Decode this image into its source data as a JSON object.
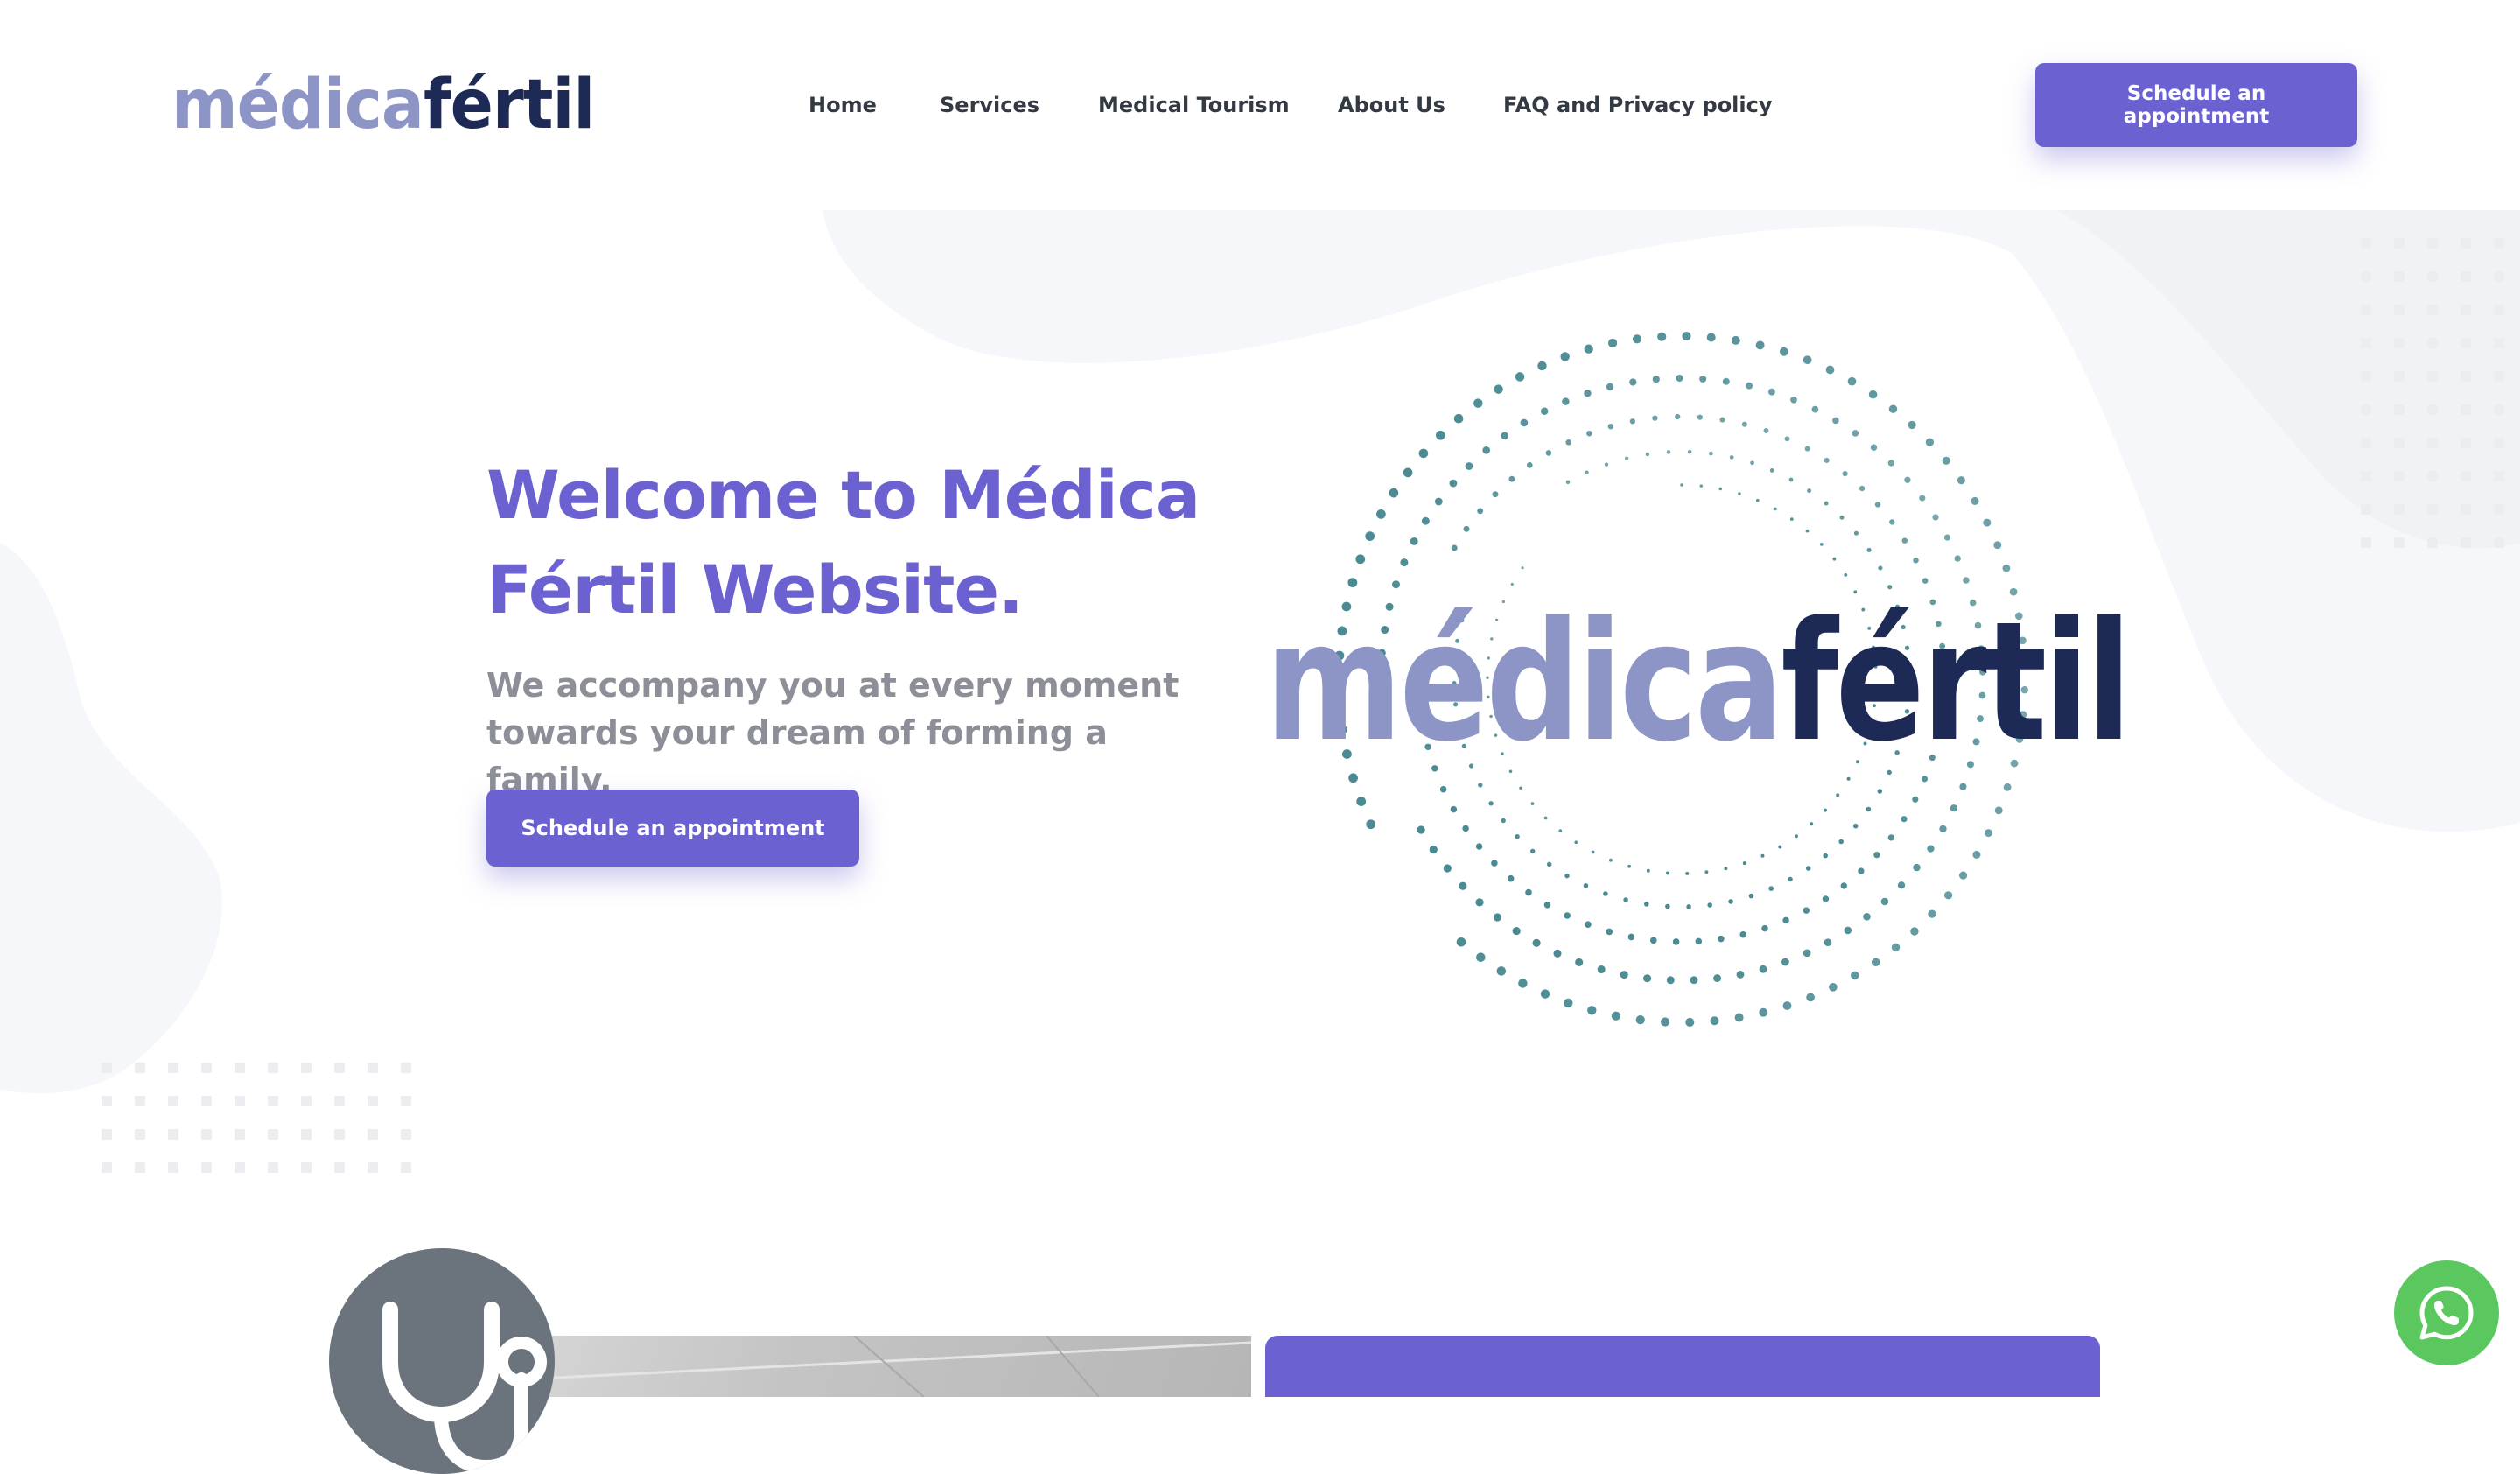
{
  "brand": {
    "logo_part1": "médica",
    "logo_part2": "fértil"
  },
  "nav": {
    "items": [
      {
        "label": "Home"
      },
      {
        "label": "Services"
      },
      {
        "label": "Medical Tourism"
      },
      {
        "label": "About Us"
      },
      {
        "label": "FAQ and Privacy policy"
      }
    ],
    "cta_label": "Schedule an appointment"
  },
  "hero": {
    "title": "Welcome to Médica Fértil Website.",
    "subtitle": "We accompany you at every moment towards your dream of forming a family.",
    "cta_label": "Schedule an appointment",
    "graphic_logo_part1": "médica",
    "graphic_logo_part2": "fértil"
  },
  "services": {
    "icon": "stethoscope-icon"
  },
  "floating": {
    "icon": "whatsapp-icon"
  },
  "colors": {
    "primary": "#6c61d0",
    "logo_light": "#8d95c6",
    "logo_dark": "#1e2a56",
    "dots": "#4a8a92",
    "subtitle": "#8d8f98",
    "whatsapp": "#5ac85e"
  }
}
